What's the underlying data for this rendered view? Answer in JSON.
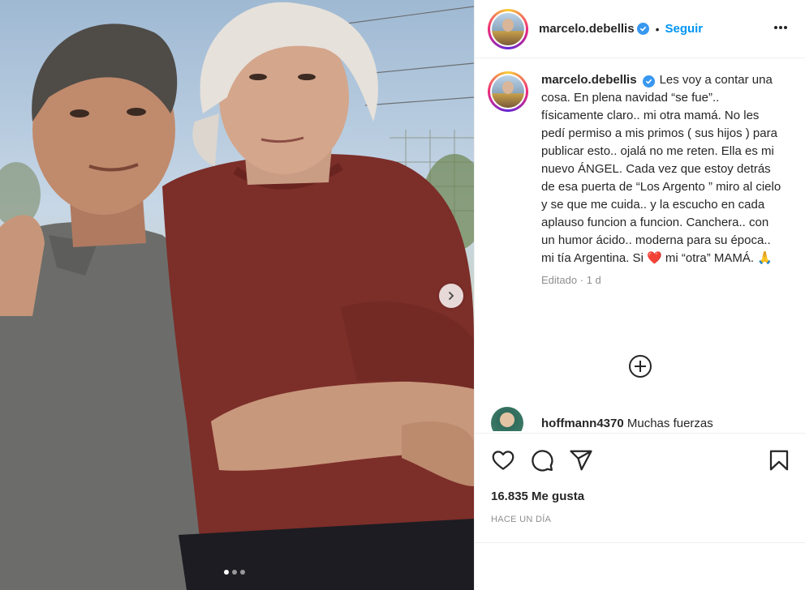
{
  "post": {
    "username": "marcelo.debellis",
    "verified": true,
    "separator": "•",
    "follow_label": "Seguir",
    "more_icon": "more-options-icon",
    "caption": "Les voy a contar una cosa. En plena navidad “se fue”.. físicamente claro.. mi otra mamá. No les pedí permiso a mis primos ( sus hijos ) para publicar esto.. ojalá no me reten. Ella es mi nuevo ÁNGEL. Cada vez que estoy detrás de esa puerta de “Los Argento ” miro al cielo y se que me cuida.. y la escucho en cada aplauso funcion a funcion. Canchera.. con un humor ácido.. moderna para su época.. mi tía Argentina. Si ❤️ mi “otra” MAMÁ. 🙏",
    "edited": "Editado",
    "meta_sep": "·",
    "edited_time": "1 d",
    "likes": "16.835 Me gusta",
    "timestamp": "HACE UN DÍA",
    "carousel": {
      "count": 3,
      "active": 0
    }
  },
  "comments": [
    {
      "username": "hoffmann4370",
      "text": "Muchas fuerzas"
    }
  ],
  "icons": {
    "like": "heart-icon",
    "comment": "comment-icon",
    "share": "share-icon",
    "save": "bookmark-icon",
    "load_more": "plus-circle-icon",
    "next": "chevron-right-icon"
  },
  "colors": {
    "link": "#0095f6",
    "verified": "#3897f0",
    "secondary_text": "#8e8e8e",
    "border": "#efefef"
  }
}
